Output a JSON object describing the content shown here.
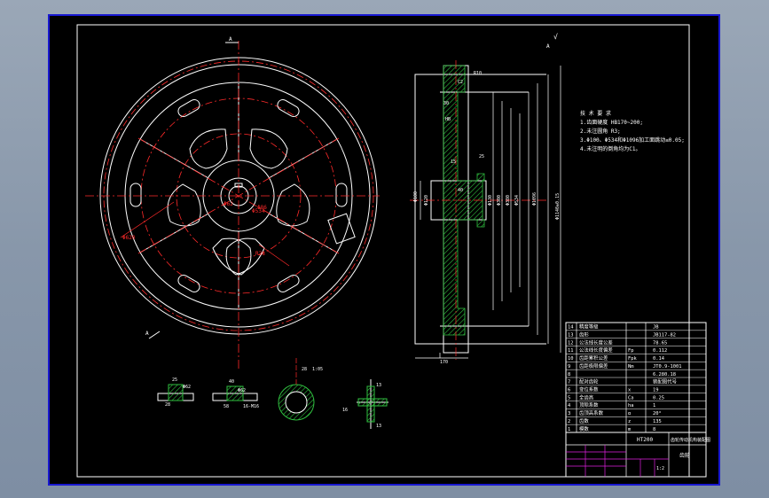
{
  "notes": {
    "header": "技 术 要 求",
    "lines": [
      "1.齿面硬度 HB170~200;",
      "2.未注圆角 R3;",
      "3.Φ100、Φ534和Φ1096加工面跳动≤0.05;",
      "4.未注明的倒角均为C1。"
    ]
  },
  "front_view": {
    "labels": [
      "Φ620",
      "Φ534",
      "R28",
      "Φ86",
      "Φ62"
    ],
    "section_marks": [
      "A",
      "A"
    ]
  },
  "section_view": {
    "labels": [
      "Φ100",
      "Φ120",
      "Φ130",
      "Φ300",
      "Φ380",
      "Φ534",
      "Φ1096",
      "Φ1140±0.15",
      "25",
      "15",
      "30",
      "170",
      "40",
      "R10",
      "C2",
      "A",
      "HB"
    ],
    "angle_note": "√"
  },
  "details": {
    "keyway": {
      "labels": [
        "25",
        "28",
        "Φ62"
      ]
    },
    "spline": {
      "labels": [
        "40",
        "58",
        "Φ62",
        "16-M16"
      ]
    },
    "hub_section": {
      "labels": [
        "28",
        "1:05"
      ]
    },
    "rib_section": {
      "labels": [
        "13",
        "16",
        "13"
      ]
    }
  },
  "params": {
    "rows": [
      {
        "no": "14",
        "name": "精度等级",
        "sym": "",
        "val": "JB"
      },
      {
        "no": "13",
        "name": "齿形",
        "sym": "",
        "val": "JB117-82"
      },
      {
        "no": "12",
        "name": "公法线长度公差",
        "sym": "",
        "val": "78.65"
      },
      {
        "no": "11",
        "name": "公法线长度偏差",
        "sym": "Fp",
        "val": "0.112"
      },
      {
        "no": "10",
        "name": "齿距累积公差",
        "sym": "Fpk",
        "val": "0.14"
      },
      {
        "no": "9",
        "name": "齿距极限偏差",
        "sym": "Nm",
        "val": "JT0.9-1001"
      },
      {
        "no": "8",
        "name": "",
        "sym": "",
        "val": "6.280.18"
      },
      {
        "no": "7",
        "name": "配对齿轮",
        "sym": "",
        "val": "装配图代号"
      },
      {
        "no": "6",
        "name": "变位系数",
        "sym": "x",
        "val": "19"
      },
      {
        "no": "5",
        "name": "全齿高",
        "sym": "Ca",
        "val": "0.25"
      },
      {
        "no": "4",
        "name": "顶隙系数",
        "sym": "ha",
        "val": "1"
      },
      {
        "no": "3",
        "name": "齿顶高系数",
        "sym": "α",
        "val": "20°"
      },
      {
        "no": "2",
        "name": "齿数",
        "sym": "z",
        "val": "135"
      },
      {
        "no": "1",
        "name": "模数",
        "sym": "m",
        "val": "8"
      }
    ]
  },
  "title_block": {
    "material": "HT200",
    "title": "齿轮传动机构装配图",
    "code": "齿轮",
    "scale": "1:2"
  },
  "colors": {
    "background": "#000000",
    "line": "#ffffff",
    "center": "#ff2a2a",
    "section_fill": "#2fbf3f",
    "hatch": "#2fbf3f",
    "dim": "#ffffff",
    "cyan": "#33e0ff",
    "magenta": "#e020e0",
    "border": "#1818d0"
  }
}
